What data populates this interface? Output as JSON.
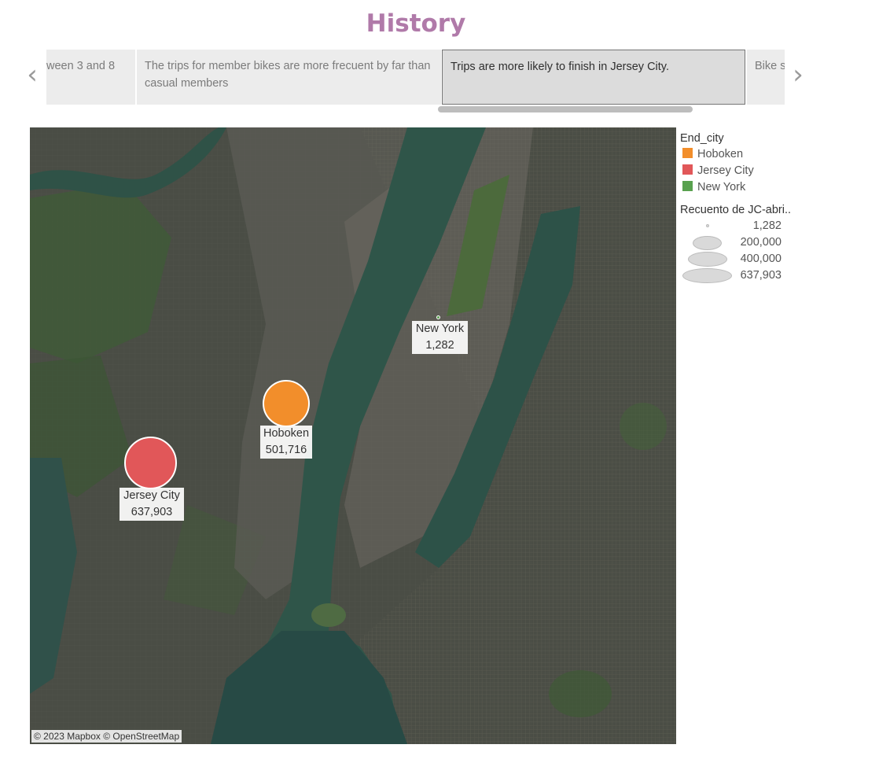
{
  "title": "History",
  "story_points": [
    {
      "text": "ween 3 and 8"
    },
    {
      "text": "The trips for member bikes are more  frecuent by far than casual members"
    },
    {
      "text": "Trips are more likely to finish in Jersey City.",
      "selected": true
    },
    {
      "text": "Bike s"
    }
  ],
  "navigation": {
    "prev_icon": "chevron-left-icon",
    "next_icon": "chevron-right-icon"
  },
  "map": {
    "attribution": "© 2023 Mapbox © OpenStreetMap",
    "marks": [
      {
        "city": "New York",
        "value": "1,282",
        "color": "#59a14f"
      },
      {
        "city": "Hoboken",
        "value": "501,716",
        "color": "#f28e2b"
      },
      {
        "city": "Jersey City",
        "value": "637,903",
        "color": "#e15759"
      }
    ]
  },
  "legend": {
    "color_title": "End_city",
    "color_items": [
      {
        "label": "Hoboken",
        "color": "#f28e2b"
      },
      {
        "label": "Jersey City",
        "color": "#e15759"
      },
      {
        "label": "New York",
        "color": "#59a14f"
      }
    ],
    "size_title": "Recuento de JC-abri..",
    "size_items": [
      {
        "label": "1,282"
      },
      {
        "label": "200,000"
      },
      {
        "label": "400,000"
      },
      {
        "label": "637,903"
      }
    ]
  },
  "colors": {
    "title": "#b07aa9"
  }
}
